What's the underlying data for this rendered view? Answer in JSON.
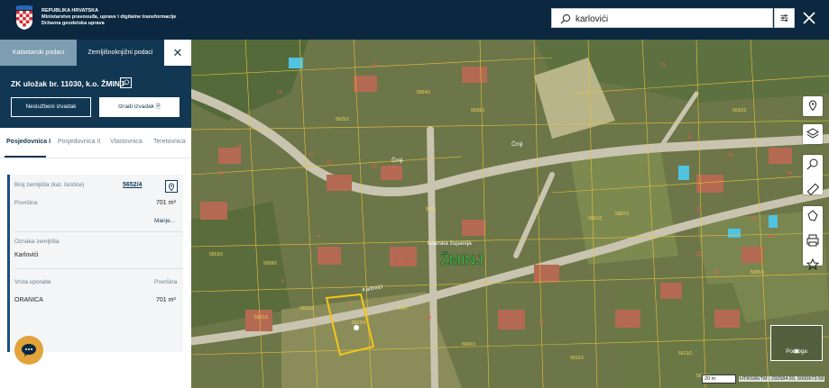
{
  "header": {
    "brand_line1": "REPUBLIKA HRVATSKA",
    "brand_line2": "Ministarstvo pravosuđa, uprave i digitalne transformacije",
    "brand_line3": "Državna geodetska uprava",
    "search_value": "karlovići"
  },
  "panel": {
    "tab_cadastre": "Katastarski podaci",
    "tab_landbook": "Zemljišnoknjižni podaci",
    "title": "ZK uložak br. 11030, k.o. ŽMINJ",
    "btn_unofficial": "Neslužbeni izvadak",
    "btn_create": "Izradi izvadak",
    "section_tabs": [
      "Posjedovnica I",
      "Posjedovnica II",
      "Vlastovnica",
      "Teretovnica"
    ],
    "parcel_label": "Broj zemljišta (kat. čestice)",
    "parcel_value": "5652/4",
    "area_label": "Površina",
    "area_value": "701 m²",
    "less_link": "Manje...",
    "mark_label": "Oznaka zemljišta",
    "mark_value": "Karlovići",
    "use_label": "Vrsta uporabe",
    "use_area_label": "Površina",
    "use_value": "ORANICA",
    "use_area_value": "701 m²"
  },
  "map": {
    "road_label_1": "Črnji",
    "road_label_2": "Črnji",
    "road_label_3": "Karlovići",
    "region_label": "Istarska županija",
    "town_label": "ŽMINJ",
    "parcel_labels": [
      "5652/4",
      "5652/3",
      "5651/1",
      "5653/1",
      "5658/1",
      "5655",
      "5657",
      "5660/1",
      "5661/2",
      "5687/1",
      "5685/1",
      "5630/3",
      "5625/1",
      "5638/1",
      "5604/1",
      "5613/1",
      "5615/1",
      "5616/1"
    ],
    "house_numbers": [
      "3",
      "4",
      "6",
      "8",
      "10",
      "11",
      "12",
      "13",
      "14",
      "15",
      "16",
      "17",
      "18",
      "19",
      "20",
      "21",
      "22",
      "24",
      "26",
      "1C",
      "3A",
      "5A",
      "9A",
      "10"
    ],
    "basemap_label": "Podloga",
    "scale_label": "20 m",
    "coords": "HTRS96/TM | 292584.50, 5000673.58"
  }
}
